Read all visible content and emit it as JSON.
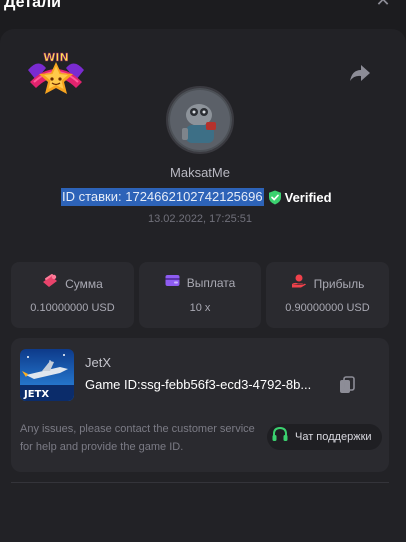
{
  "header": {
    "title": "Детали"
  },
  "player": {
    "username": "MaksatMe"
  },
  "bet": {
    "id_text": "ID ставки: 1724662102742125696",
    "verified": "Verified",
    "datetime": "13.02.2022, 17:25:51"
  },
  "stats": [
    {
      "label": "Сумма",
      "value": "0.10000000 USD",
      "icon": "coins-icon"
    },
    {
      "label": "Выплата",
      "value": "10 x",
      "icon": "wallet-icon"
    },
    {
      "label": "Прибыль",
      "value": "0.90000000 USD",
      "icon": "hand-coin-icon"
    }
  ],
  "game": {
    "name": "JetX",
    "id_text": "Game ID:ssg-febb56f3-ecd3-4792-8b...",
    "thumb_label": "JETX",
    "support_note": "Any issues, please contact the customer service for help and provide the game ID.",
    "support_button": "Чат поддержки"
  },
  "colors": {
    "accent_green": "#3bd16f",
    "selection_blue": "#2d63b8",
    "stat_pink": "#e8436b",
    "stat_purple": "#8e5cf2",
    "stat_red": "#f0414b"
  }
}
